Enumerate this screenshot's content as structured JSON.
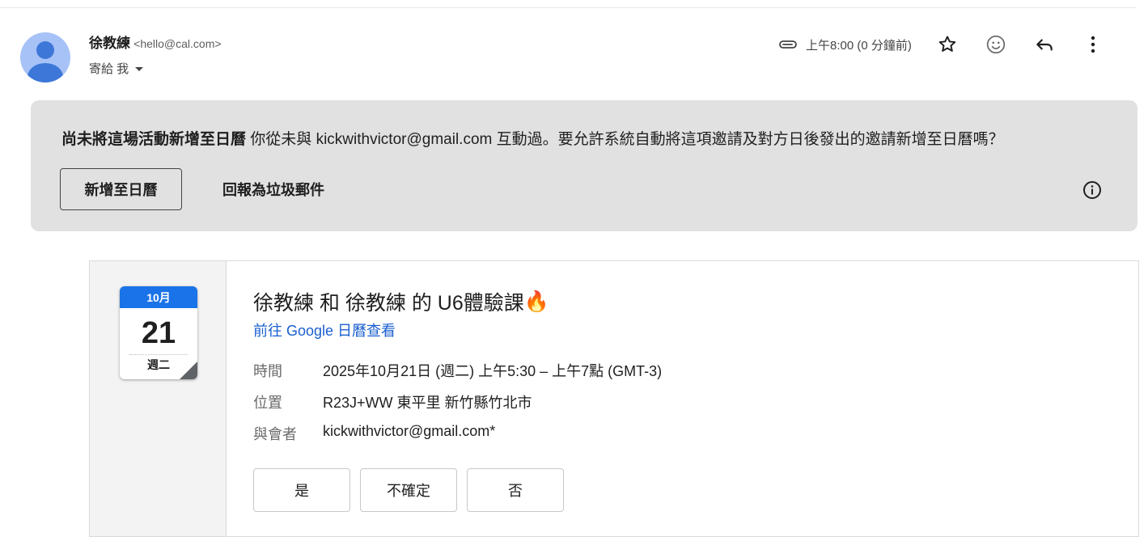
{
  "sender": {
    "name": "徐教練",
    "email": "<hello@cal.com>",
    "to_label": "寄給 我"
  },
  "meta": {
    "time": "上午8:00 (0 分鐘前)"
  },
  "icons": {
    "attachment": "paperclip-icon",
    "star": "star-icon",
    "emoji": "emoji-icon",
    "reply": "reply-icon",
    "more": "more-vert-icon",
    "info": "info-icon"
  },
  "banner": {
    "text_bold": "尚未將這場活動新增至日曆",
    "text": " 你從未與 kickwithvictor@gmail.com 互動過。要允許系統自動將這項邀請及對方日後發出的邀請新增至日曆嗎？",
    "add_button": "新增至日曆",
    "spam_button": "回報為垃圾郵件"
  },
  "event": {
    "cal_month": "10月",
    "cal_day": "21",
    "cal_weekday": "週二",
    "title": "徐教練 和 徐教練 的 U6體驗課",
    "title_emoji": "🔥",
    "link": "前往 Google 日曆查看",
    "details": [
      {
        "label": "時間",
        "value": "2025年10月21日 (週二) 上午5:30 – 上午7點 (GMT-3)"
      },
      {
        "label": "位置",
        "value": "R23J+WW 東平里 新竹縣竹北市"
      },
      {
        "label": "與會者",
        "value": "kickwithvictor@gmail.com*"
      }
    ],
    "rsvp": {
      "yes": "是",
      "maybe": "不確定",
      "no": "否"
    }
  },
  "colors": {
    "accent": "#1a73e8",
    "link": "#1a5fcf",
    "banner_bg": "#e1e1e1"
  }
}
